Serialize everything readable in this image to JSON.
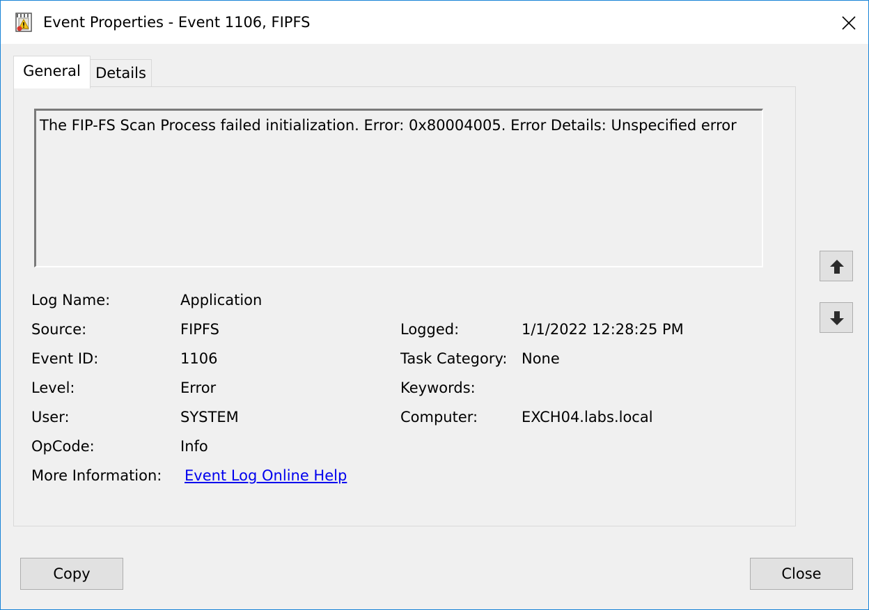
{
  "window": {
    "title": "Event Properties - Event 1106, FIPFS"
  },
  "tabs": [
    {
      "label": "General",
      "selected": true
    },
    {
      "label": "Details",
      "selected": false
    }
  ],
  "description": "The FIP-FS Scan Process failed initialization. Error: 0x80004005. Error Details: Unspecified error",
  "fields": {
    "log_name": {
      "label": "Log Name:",
      "value": "Application"
    },
    "source": {
      "label": "Source:",
      "value": "FIPFS"
    },
    "logged": {
      "label": "Logged:",
      "value": "1/1/2022 12:28:25 PM"
    },
    "event_id": {
      "label": "Event ID:",
      "value": "1106"
    },
    "task_category": {
      "label": "Task Category:",
      "value": "None"
    },
    "level": {
      "label": "Level:",
      "value": "Error"
    },
    "keywords": {
      "label": "Keywords:",
      "value": ""
    },
    "user": {
      "label": "User:",
      "value": "SYSTEM"
    },
    "computer": {
      "label": "Computer:",
      "value": "EXCH04.labs.local"
    },
    "opcode": {
      "label": "OpCode:",
      "value": "Info"
    },
    "more_info": {
      "label": "More Information:",
      "link_text": "Event Log Online Help"
    }
  },
  "icons": {
    "app": "event-viewer-icon",
    "close": "close-icon",
    "up": "arrow-up-icon",
    "down": "arrow-down-icon"
  },
  "buttons": {
    "copy": "Copy",
    "close": "Close"
  },
  "colors": {
    "window_border": "#1883d7",
    "link": "#0000ee",
    "button_face": "#e1e1e1"
  }
}
